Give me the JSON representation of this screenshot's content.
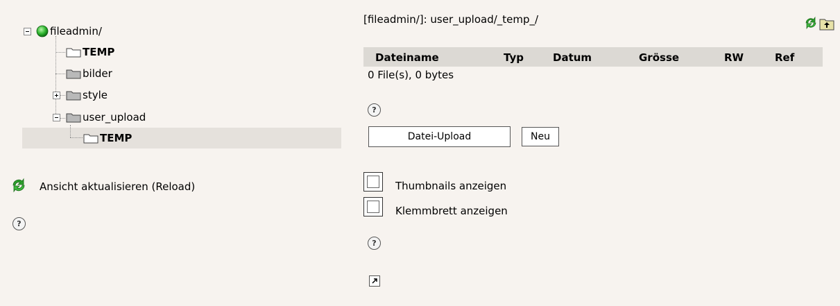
{
  "tree": {
    "root": "fileadmin/",
    "items": [
      {
        "label": "TEMP"
      },
      {
        "label": "bilder"
      },
      {
        "label": "style"
      },
      {
        "label": "user_upload"
      },
      {
        "label": "TEMP"
      }
    ]
  },
  "sidebar": {
    "reload_label": "Ansicht aktualisieren (Reload)",
    "help_glyph": "?"
  },
  "main": {
    "path": "[fileadmin/]: user_upload/_temp_/",
    "columns": [
      "Dateiname",
      "Typ",
      "Datum",
      "Grösse",
      "RW",
      "Ref"
    ],
    "summary": "0 File(s), 0 bytes",
    "help_glyph": "?",
    "upload_button": "Datei-Upload",
    "new_button": "Neu",
    "option_thumbnails": "Thumbnails anzeigen",
    "option_clipboard": "Klemmbrett anzeigen",
    "thumbnails_checked": false,
    "clipboard_checked": false
  },
  "colors": {
    "background": "#f7f3ef",
    "header_bar": "#dcd9d4",
    "selected_row": "#e5e1dc",
    "globe_green": "#2fb52f",
    "reload_green": "#2e9e2e"
  }
}
